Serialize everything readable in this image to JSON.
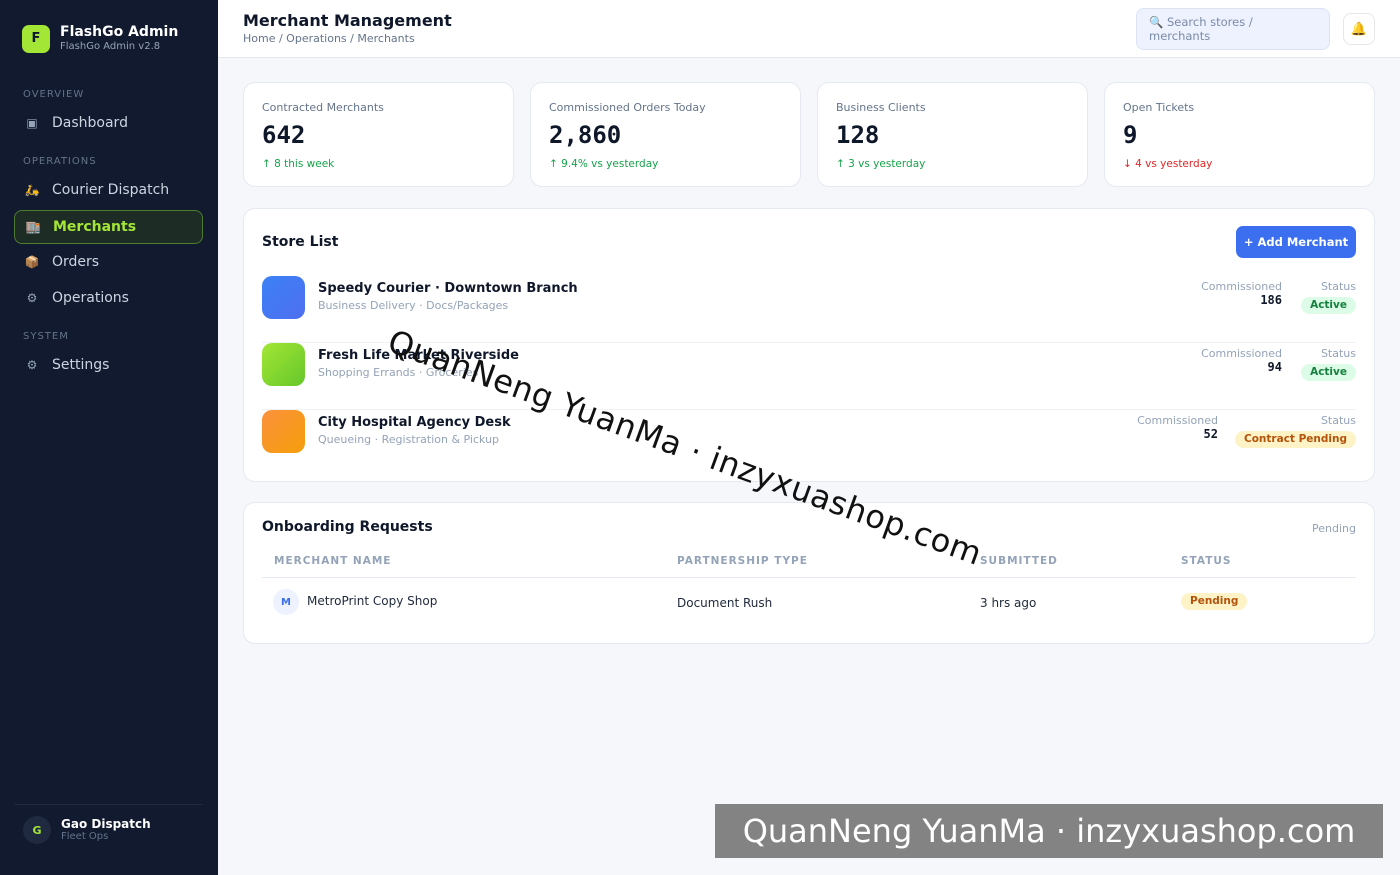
{
  "brand": {
    "logo_letter": "F",
    "name": "FlashGo Admin",
    "version": "FlashGo Admin v2.8"
  },
  "nav": {
    "sections": [
      "OVERVIEW",
      "OPERATIONS",
      "SYSTEM"
    ],
    "items": [
      {
        "label": "Dashboard",
        "icon": "dashboard-icon",
        "glyph": "▣"
      },
      {
        "label": "Courier Dispatch",
        "icon": "scooter-icon",
        "glyph": "🛵"
      },
      {
        "label": "Merchants",
        "icon": "building-icon",
        "glyph": "🏬",
        "active": true
      },
      {
        "label": "Orders",
        "icon": "package-icon",
        "glyph": "📦"
      },
      {
        "label": "Operations",
        "icon": "gear-icon",
        "glyph": "⚙"
      },
      {
        "label": "Settings",
        "icon": "settings-icon",
        "glyph": "⚙"
      }
    ]
  },
  "user": {
    "initial": "G",
    "name": "Gao Dispatch",
    "role": "Fleet Ops"
  },
  "header": {
    "title": "Merchant Management",
    "breadcrumb": "Home / Operations / Merchants",
    "search_placeholder": "🔍 Search stores / merchants",
    "bell_glyph": "🔔"
  },
  "stats": [
    {
      "label": "Contracted Merchants",
      "value": "642",
      "trend": "↑ 8 this week",
      "direction": "up"
    },
    {
      "label": "Commissioned Orders Today",
      "value": "2,860",
      "trend": "↑ 9.4% vs yesterday",
      "direction": "up"
    },
    {
      "label": "Business Clients",
      "value": "128",
      "trend": "↑ 3 vs yesterday",
      "direction": "up"
    },
    {
      "label": "Open Tickets",
      "value": "9",
      "trend": "↓ 4 vs yesterday",
      "direction": "down"
    }
  ],
  "store_list": {
    "title": "Store List",
    "add_button": "+ Add Merchant",
    "commission_label": "Commissioned",
    "status_label": "Status",
    "stores": [
      {
        "name": "Speedy Courier · Downtown Branch",
        "subtitle": "Business Delivery · Docs/Packages",
        "commissioned": "186",
        "status": "Active",
        "color": "#3b6ff0"
      },
      {
        "name": "Fresh Life Market Riverside",
        "subtitle": "Shopping Errands · Groceries",
        "commissioned": "94",
        "status": "Active",
        "color": "#84cc16"
      },
      {
        "name": "City Hospital Agency Desk",
        "subtitle": "Queueing · Registration & Pickup",
        "commissioned": "52",
        "status": "Contract Pending",
        "color": "#f59e0b"
      }
    ]
  },
  "onboarding": {
    "title": "Onboarding Requests",
    "filter_label": "Pending",
    "columns": [
      "MERCHANT NAME",
      "PARTNERSHIP TYPE",
      "SUBMITTED",
      "STATUS"
    ],
    "rows": [
      {
        "initial": "M",
        "merchant": "MetroPrint Copy Shop",
        "type": "Document Rush",
        "submitted": "3 hrs ago",
        "status": "Pending"
      }
    ]
  },
  "watermark": {
    "text": "QuanNeng YuanMa · inzyxuashop.com"
  },
  "colors": {
    "sidebar_bg": "#111a2e",
    "accent_lime": "#a3e635",
    "primary_blue": "#3b6ff0",
    "success": "#16a34a",
    "danger": "#dc2626"
  }
}
